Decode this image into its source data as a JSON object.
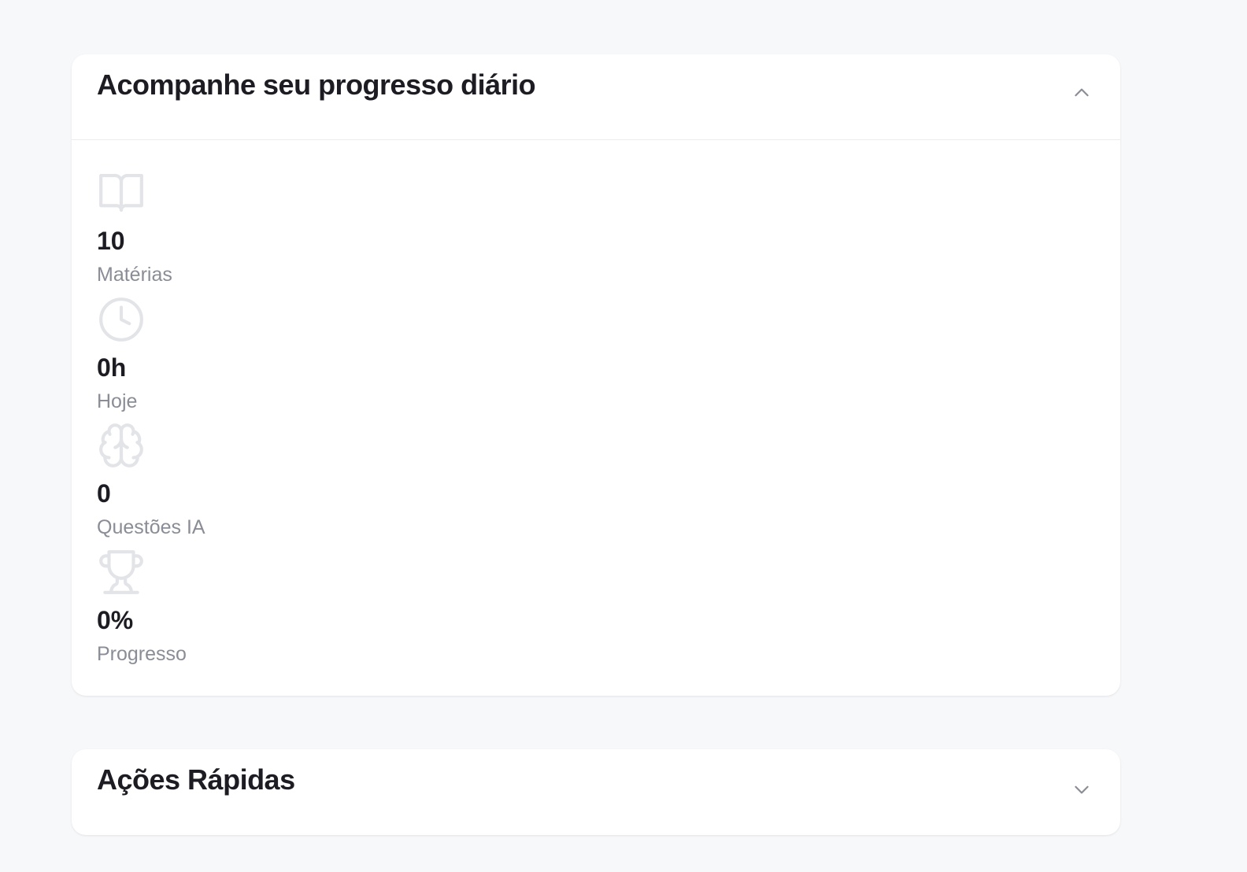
{
  "progress_card": {
    "title": "Acompanhe seu progresso diário",
    "collapse_icon": "chevron-up-icon",
    "stats": [
      {
        "icon": "book-open-icon",
        "value": "10",
        "label": "Matérias"
      },
      {
        "icon": "clock-icon",
        "value": "0h",
        "label": "Hoje"
      },
      {
        "icon": "brain-icon",
        "value": "0",
        "label": "Questões IA"
      },
      {
        "icon": "trophy-icon",
        "value": "0%",
        "label": "Progresso"
      }
    ]
  },
  "actions_card": {
    "title": "Ações Rápidas",
    "expand_icon": "chevron-down-icon"
  },
  "colors": {
    "background": "#f7f8fa",
    "card": "#ffffff",
    "title_text": "#1c1c22",
    "label_text": "#8a8d96",
    "icon_muted": "#e3e4e8",
    "chevron": "#8a8d96"
  }
}
